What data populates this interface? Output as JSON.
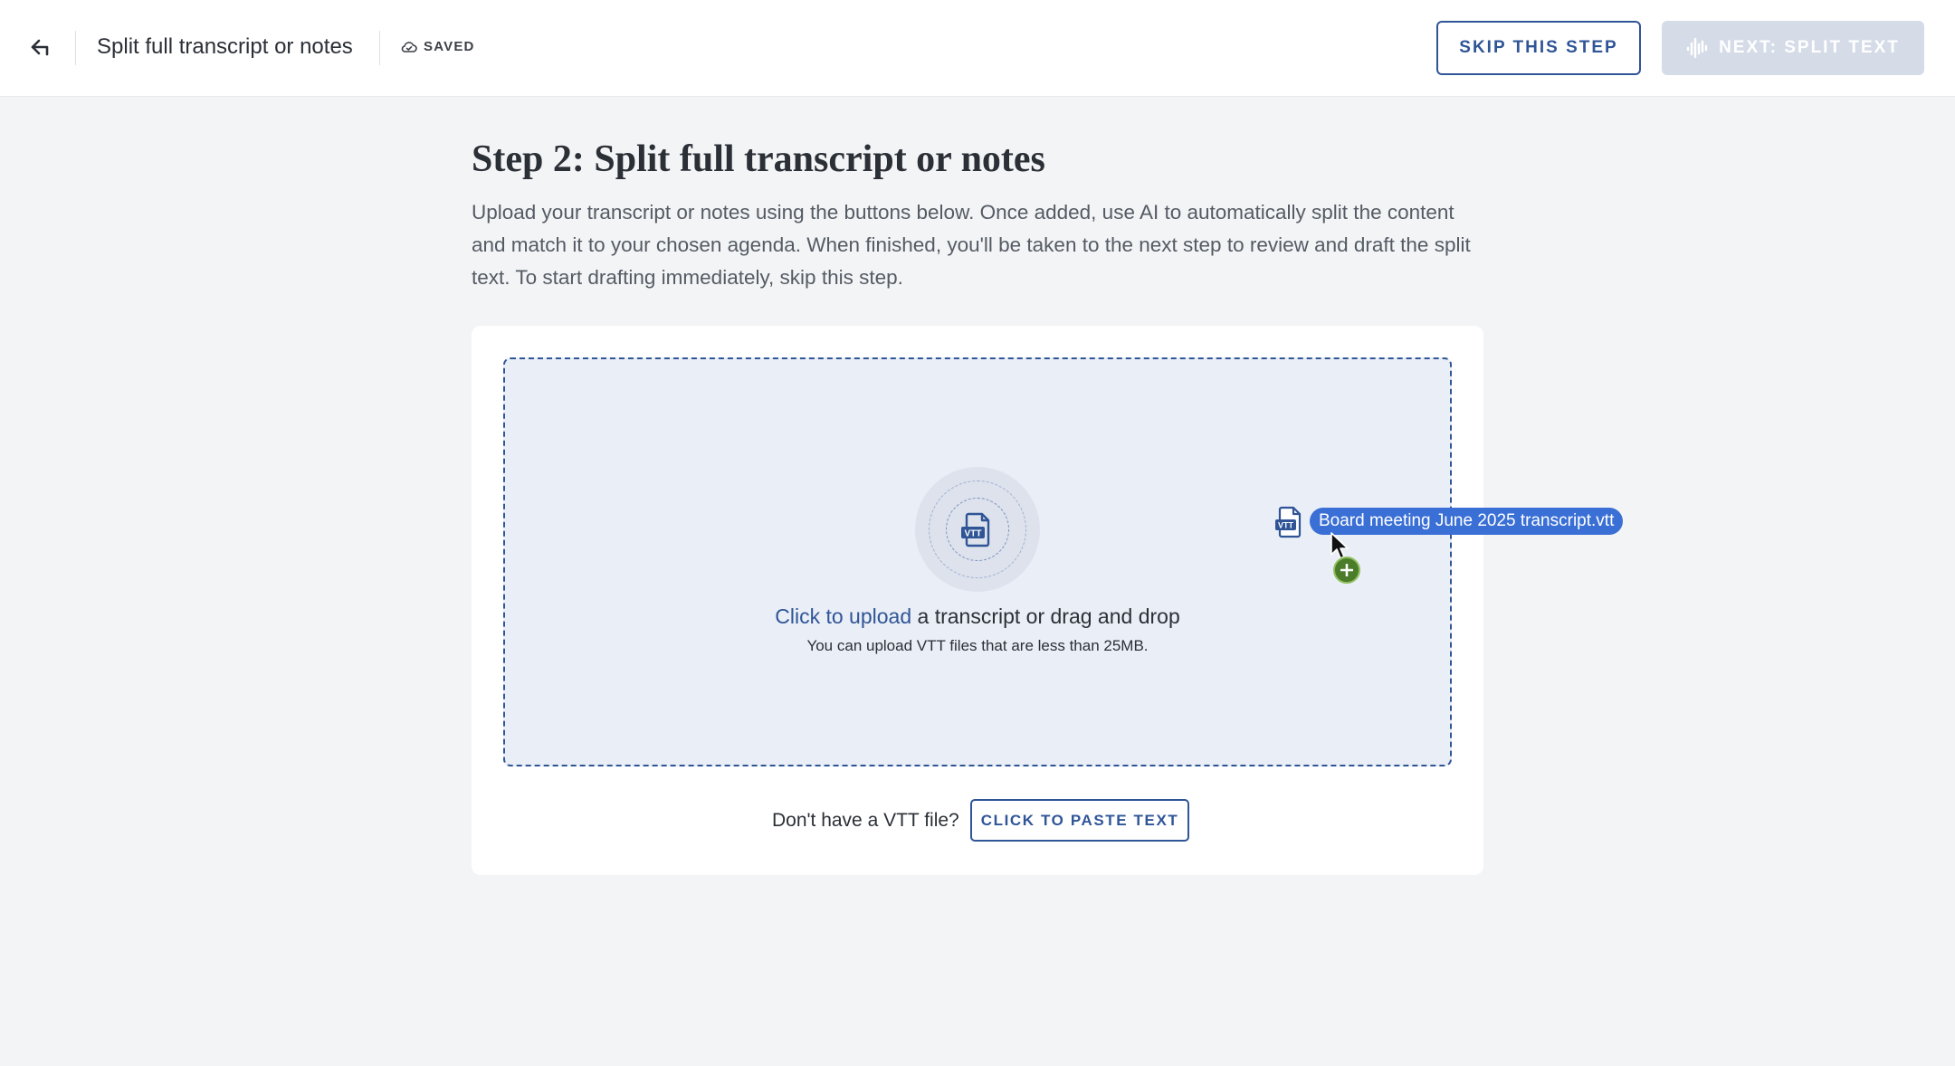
{
  "header": {
    "title": "Split full transcript or notes",
    "saved_label": "SAVED",
    "skip_label": "SKIP THIS STEP",
    "next_label": "NEXT: SPLIT TEXT"
  },
  "main": {
    "heading": "Step 2: Split full transcript or notes",
    "description": "Upload your transcript or notes using the buttons below. Once added, use AI to automatically split the content and match it to your chosen agenda. When finished, you'll be taken to the next step to review and draft the split text. To start drafting immediately, skip this step."
  },
  "dropzone": {
    "icon_label": "VTT",
    "link_text": "Click to upload",
    "rest_text": " a transcript or drag and drop",
    "hint": "You can upload VTT files that are less than 25MB."
  },
  "paste": {
    "label": "Don't have a VTT file?",
    "button_label": "CLICK TO PASTE TEXT"
  },
  "drag": {
    "file_name": "Board meeting June 2025 transcript.vtt",
    "icon_label": "VTT"
  },
  "colors": {
    "accent": "#2f5597",
    "drag_chip": "#3a6fd6",
    "copy_badge": "#4a7c2a",
    "disabled_button": "#d5dce8"
  },
  "icons": {
    "back": "arrow-left-icon",
    "saved": "cloud-check-icon",
    "next": "waveform-icon",
    "upload": "vtt-file-icon",
    "cursor": "mouse-pointer-icon",
    "copy": "plus-icon"
  }
}
